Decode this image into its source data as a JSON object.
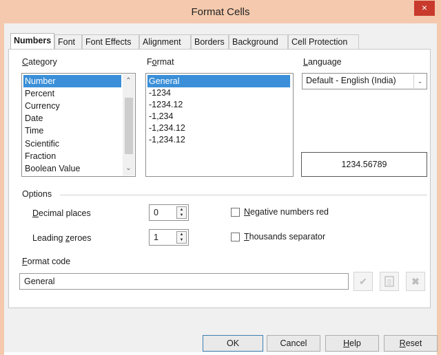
{
  "window": {
    "title": "Format Cells",
    "close_glyph": "×"
  },
  "tabs": [
    {
      "label": "Numbers"
    },
    {
      "label": "Font"
    },
    {
      "label": "Font Effects"
    },
    {
      "label": "Alignment"
    },
    {
      "label": "Borders"
    },
    {
      "label": "Background"
    },
    {
      "label": "Cell Protection"
    }
  ],
  "category": {
    "label_first": "C",
    "label_rest": "ategory",
    "items": [
      "Number",
      "Percent",
      "Currency",
      "Date",
      "Time",
      "Scientific",
      "Fraction",
      "Boolean Value"
    ],
    "selected": "Number"
  },
  "format": {
    "label_first": "F",
    "label_mid": "o",
    "label_rest": "rmat",
    "items": [
      "General",
      "-1234",
      "-1234.12",
      "-1,234",
      "-1,234.12",
      "-1,234.12"
    ],
    "selected": "General"
  },
  "language": {
    "label_first": "L",
    "label_rest": "anguage",
    "value": "Default - English (India)"
  },
  "preview": {
    "value": "1234.56789"
  },
  "options": {
    "heading": "Options",
    "decimal_places": {
      "label_first": "D",
      "label_rest": "ecimal places",
      "value": "0"
    },
    "leading_zeroes": {
      "label_pre": "Leading ",
      "label_u": "z",
      "label_rest": "eroes",
      "value": "1"
    },
    "negative_red": {
      "label_first": "N",
      "label_rest": "egative numbers red",
      "checked": false
    },
    "thousands_sep": {
      "label_first": "T",
      "label_rest": "housands separator",
      "checked": false
    }
  },
  "format_code": {
    "label_first": "F",
    "label_rest": "ormat code",
    "value": "General"
  },
  "icons": {
    "accept": "check-icon",
    "comment": "comment-icon",
    "remove": "delete-icon"
  },
  "buttons": {
    "ok": "OK",
    "cancel": "Cancel",
    "help_first": "H",
    "help_rest": "elp",
    "reset_first": "R",
    "reset_rest": "eset"
  },
  "colors": {
    "selection": "#3a8fd8",
    "titlebar": "#f4c9ad",
    "close": "#c83a2c"
  }
}
